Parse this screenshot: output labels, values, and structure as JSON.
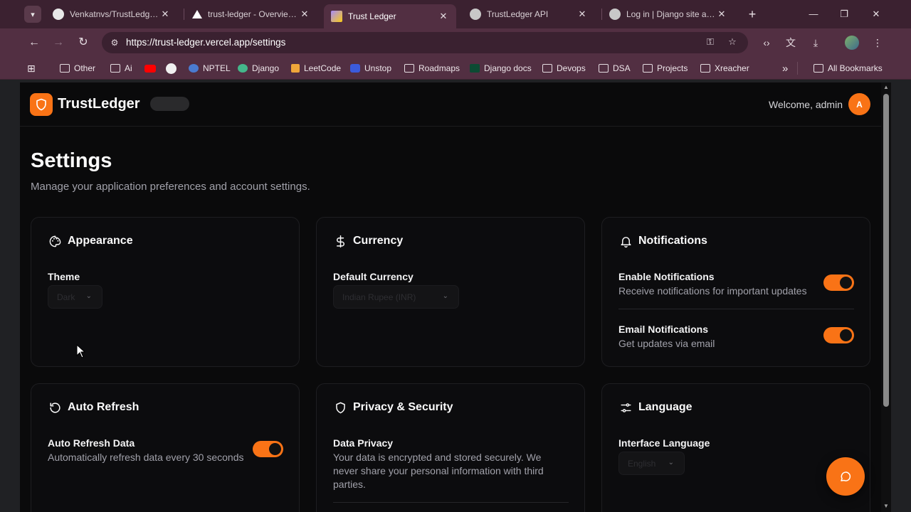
{
  "browser": {
    "tabs": [
      {
        "title": "Venkatnvs/TrustLedger: A",
        "icon": "github-icon"
      },
      {
        "title": "trust-ledger - Overview -",
        "icon": "vercel-icon"
      },
      {
        "title": "Trust Ledger",
        "icon": "vite-icon",
        "active": true
      },
      {
        "title": "TrustLedger API",
        "icon": "globe-icon"
      },
      {
        "title": "Log in | Django site admin",
        "icon": "globe-icon"
      }
    ],
    "url": "https://trust-ledger.vercel.app/settings",
    "bookmarks": [
      "Other",
      "Ai",
      "",
      "",
      "NPTEL",
      "Django",
      "LeetCode",
      "Unstop",
      "Roadmaps",
      "Django docs",
      "Devops",
      "DSA",
      "Projects",
      "Xreacher"
    ],
    "all_bookmarks": "All Bookmarks",
    "overflow": "»"
  },
  "app": {
    "brand": "TrustLedger",
    "welcome": "Welcome, admin",
    "avatar_initial": "A",
    "accent": "#f97316"
  },
  "settings": {
    "title": "Settings",
    "subtitle": "Manage your application preferences and account settings.",
    "appearance": {
      "heading": "Appearance",
      "theme_label": "Theme",
      "theme_value": "Dark"
    },
    "currency": {
      "heading": "Currency",
      "default_label": "Default Currency",
      "default_value": "Indian Rupee (INR)"
    },
    "notifications": {
      "heading": "Notifications",
      "enable_label": "Enable Notifications",
      "enable_desc": "Receive notifications for important updates",
      "enable_on": true,
      "email_label": "Email Notifications",
      "email_desc": "Get updates via email",
      "email_on": true
    },
    "auto_refresh": {
      "heading": "Auto Refresh",
      "label": "Auto Refresh Data",
      "desc": "Automatically refresh data every 30 seconds",
      "on": true
    },
    "privacy": {
      "heading": "Privacy & Security",
      "label": "Data Privacy",
      "desc": "Your data is encrypted and stored securely. We never share your personal information with third parties."
    },
    "language": {
      "heading": "Language",
      "label": "Interface Language",
      "value": "English"
    }
  }
}
